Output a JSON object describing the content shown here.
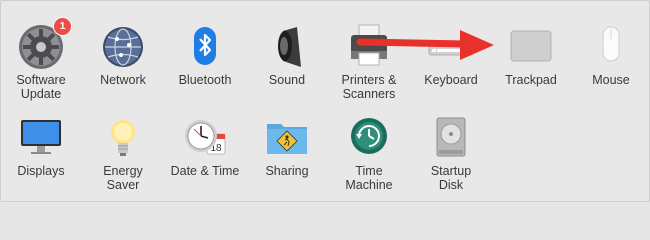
{
  "row1": [
    {
      "label": "Software\nUpdate",
      "icon": "software-update-gear-icon",
      "badge": "1"
    },
    {
      "label": "Network",
      "icon": "network-globe-icon"
    },
    {
      "label": "Bluetooth",
      "icon": "bluetooth-icon"
    },
    {
      "label": "Sound",
      "icon": "speaker-icon"
    },
    {
      "label": "Printers &\nScanners",
      "icon": "printer-icon"
    },
    {
      "label": "Keyboard",
      "icon": "keyboard-icon"
    },
    {
      "label": "Trackpad",
      "icon": "trackpad-icon"
    },
    {
      "label": "Mouse",
      "icon": "mouse-icon"
    }
  ],
  "row2": [
    {
      "label": "Displays",
      "icon": "display-icon"
    },
    {
      "label": "Energy\nSaver",
      "icon": "lightbulb-icon"
    },
    {
      "label": "Date & Time",
      "icon": "clock-calendar-icon",
      "calendar_day": "18"
    },
    {
      "label": "Sharing",
      "icon": "sharing-folder-icon"
    },
    {
      "label": "Time\nMachine",
      "icon": "time-machine-icon"
    },
    {
      "label": "Startup\nDisk",
      "icon": "hard-disk-icon"
    }
  ],
  "annotation": {
    "type": "arrow",
    "color": "#e8312a",
    "points_to": "Trackpad"
  }
}
